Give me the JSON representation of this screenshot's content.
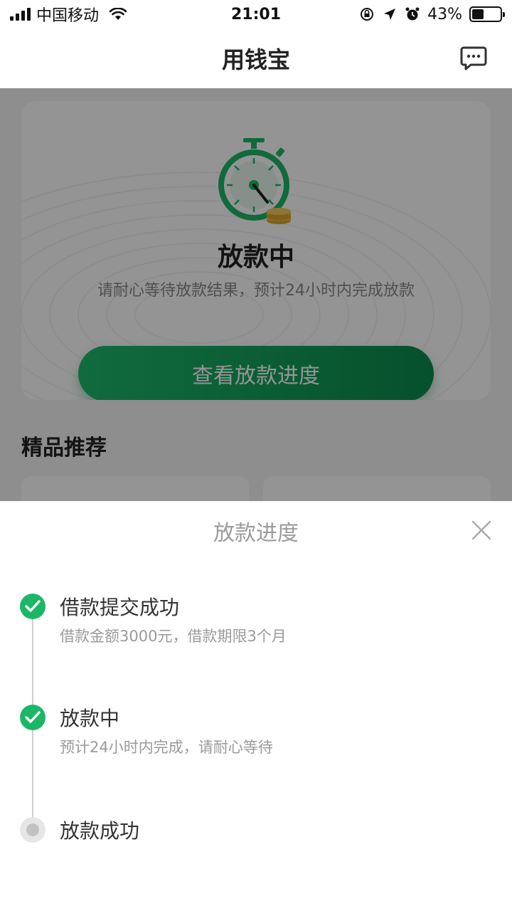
{
  "status_bar": {
    "carrier": "中国移动",
    "time": "21:01",
    "battery": "43%"
  },
  "nav": {
    "title": "用钱宝"
  },
  "card": {
    "status_title": "放款中",
    "status_subtitle": "请耐心等待放款结果，预计24小时内完成放款",
    "button_label": "查看放款进度"
  },
  "recommend": {
    "title": "精品推荐"
  },
  "sheet": {
    "title": "放款进度",
    "steps": [
      {
        "title": "借款提交成功",
        "desc": "借款金额3000元，借款期限3个月",
        "state": "done"
      },
      {
        "title": "放款中",
        "desc": "预计24小时内完成，请耐心等待",
        "state": "done"
      },
      {
        "title": "放款成功",
        "desc": "",
        "state": "pending"
      }
    ]
  },
  "colors": {
    "accent": "#1cb766",
    "accent_dark": "#0b8b4e"
  }
}
